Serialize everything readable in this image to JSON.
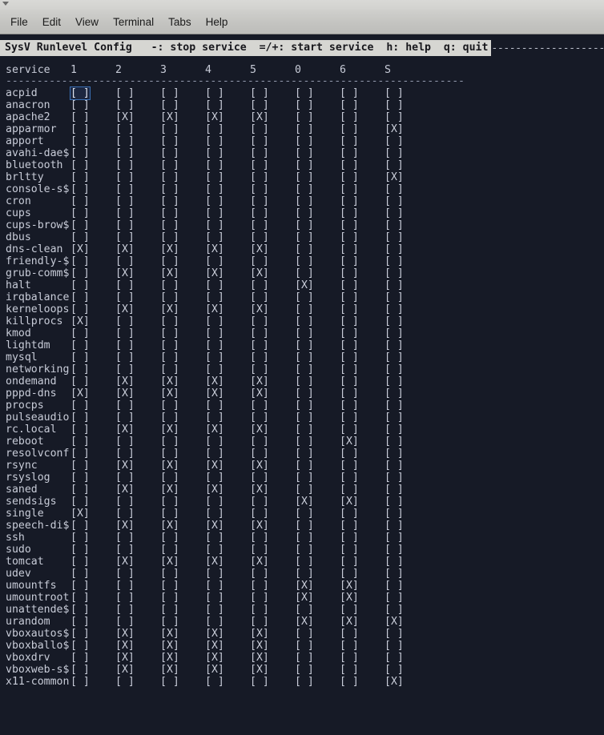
{
  "window": {
    "menu_marker_icon": "window-menu-triangle-icon",
    "menus": [
      "File",
      "Edit",
      "View",
      "Terminal",
      "Tabs",
      "Help"
    ]
  },
  "terminal": {
    "background_color": "#161a26",
    "foreground_color": "#c8ccd8",
    "status_bar_bg": "#d6d6d2",
    "status_bar_fg": "#17171c",
    "cursor_color": "#3a6fb5"
  },
  "app": {
    "title": "SysV Runlevel Config",
    "status_line": "SysV Runlevel Config   -: stop service  =/+: start service  h: help  q: quit",
    "keys": [
      {
        "key": "-",
        "action": "stop service"
      },
      {
        "key": "=/+",
        "action": "start service"
      },
      {
        "key": "h",
        "action": "help"
      },
      {
        "key": "q",
        "action": "quit"
      }
    ],
    "rule_char": "-"
  },
  "table": {
    "columns": [
      "service",
      "1",
      "2",
      "3",
      "4",
      "5",
      "0",
      "6",
      "S"
    ],
    "runlevels": [
      "1",
      "2",
      "3",
      "4",
      "5",
      "0",
      "6",
      "S"
    ],
    "divider": "--------------------------------------------------------------------------",
    "checked_glyph": "[X]",
    "unchecked_glyph": "[ ]",
    "cursor": {
      "row": 0,
      "col": 0
    },
    "rows": [
      {
        "service": "acpid",
        "states": [
          0,
          0,
          0,
          0,
          0,
          0,
          0,
          0
        ]
      },
      {
        "service": "anacron",
        "states": [
          0,
          0,
          0,
          0,
          0,
          0,
          0,
          0
        ]
      },
      {
        "service": "apache2",
        "states": [
          0,
          1,
          1,
          1,
          1,
          0,
          0,
          0
        ]
      },
      {
        "service": "apparmor",
        "states": [
          0,
          0,
          0,
          0,
          0,
          0,
          0,
          1
        ]
      },
      {
        "service": "apport",
        "states": [
          0,
          0,
          0,
          0,
          0,
          0,
          0,
          0
        ]
      },
      {
        "service": "avahi-dae$",
        "states": [
          0,
          0,
          0,
          0,
          0,
          0,
          0,
          0
        ]
      },
      {
        "service": "bluetooth",
        "states": [
          0,
          0,
          0,
          0,
          0,
          0,
          0,
          0
        ]
      },
      {
        "service": "brltty",
        "states": [
          0,
          0,
          0,
          0,
          0,
          0,
          0,
          1
        ]
      },
      {
        "service": "console-s$",
        "states": [
          0,
          0,
          0,
          0,
          0,
          0,
          0,
          0
        ]
      },
      {
        "service": "cron",
        "states": [
          0,
          0,
          0,
          0,
          0,
          0,
          0,
          0
        ]
      },
      {
        "service": "cups",
        "states": [
          0,
          0,
          0,
          0,
          0,
          0,
          0,
          0
        ]
      },
      {
        "service": "cups-brow$",
        "states": [
          0,
          0,
          0,
          0,
          0,
          0,
          0,
          0
        ]
      },
      {
        "service": "dbus",
        "states": [
          0,
          0,
          0,
          0,
          0,
          0,
          0,
          0
        ]
      },
      {
        "service": "dns-clean",
        "states": [
          1,
          1,
          1,
          1,
          1,
          0,
          0,
          0
        ]
      },
      {
        "service": "friendly-$",
        "states": [
          0,
          0,
          0,
          0,
          0,
          0,
          0,
          0
        ]
      },
      {
        "service": "grub-comm$",
        "states": [
          0,
          1,
          1,
          1,
          1,
          0,
          0,
          0
        ]
      },
      {
        "service": "halt",
        "states": [
          0,
          0,
          0,
          0,
          0,
          1,
          0,
          0
        ]
      },
      {
        "service": "irqbalance",
        "states": [
          0,
          0,
          0,
          0,
          0,
          0,
          0,
          0
        ]
      },
      {
        "service": "kerneloops",
        "states": [
          0,
          1,
          1,
          1,
          1,
          0,
          0,
          0
        ]
      },
      {
        "service": "killprocs",
        "states": [
          1,
          0,
          0,
          0,
          0,
          0,
          0,
          0
        ]
      },
      {
        "service": "kmod",
        "states": [
          0,
          0,
          0,
          0,
          0,
          0,
          0,
          0
        ]
      },
      {
        "service": "lightdm",
        "states": [
          0,
          0,
          0,
          0,
          0,
          0,
          0,
          0
        ]
      },
      {
        "service": "mysql",
        "states": [
          0,
          0,
          0,
          0,
          0,
          0,
          0,
          0
        ]
      },
      {
        "service": "networking",
        "states": [
          0,
          0,
          0,
          0,
          0,
          0,
          0,
          0
        ]
      },
      {
        "service": "ondemand",
        "states": [
          0,
          1,
          1,
          1,
          1,
          0,
          0,
          0
        ]
      },
      {
        "service": "pppd-dns",
        "states": [
          1,
          1,
          1,
          1,
          1,
          0,
          0,
          0
        ]
      },
      {
        "service": "procps",
        "states": [
          0,
          0,
          0,
          0,
          0,
          0,
          0,
          0
        ]
      },
      {
        "service": "pulseaudio",
        "states": [
          0,
          0,
          0,
          0,
          0,
          0,
          0,
          0
        ]
      },
      {
        "service": "rc.local",
        "states": [
          0,
          1,
          1,
          1,
          1,
          0,
          0,
          0
        ]
      },
      {
        "service": "reboot",
        "states": [
          0,
          0,
          0,
          0,
          0,
          0,
          1,
          0
        ]
      },
      {
        "service": "resolvconf",
        "states": [
          0,
          0,
          0,
          0,
          0,
          0,
          0,
          0
        ]
      },
      {
        "service": "rsync",
        "states": [
          0,
          1,
          1,
          1,
          1,
          0,
          0,
          0
        ]
      },
      {
        "service": "rsyslog",
        "states": [
          0,
          0,
          0,
          0,
          0,
          0,
          0,
          0
        ]
      },
      {
        "service": "saned",
        "states": [
          0,
          1,
          1,
          1,
          1,
          0,
          0,
          0
        ]
      },
      {
        "service": "sendsigs",
        "states": [
          0,
          0,
          0,
          0,
          0,
          1,
          1,
          0
        ]
      },
      {
        "service": "single",
        "states": [
          1,
          0,
          0,
          0,
          0,
          0,
          0,
          0
        ]
      },
      {
        "service": "speech-di$",
        "states": [
          0,
          1,
          1,
          1,
          1,
          0,
          0,
          0
        ]
      },
      {
        "service": "ssh",
        "states": [
          0,
          0,
          0,
          0,
          0,
          0,
          0,
          0
        ]
      },
      {
        "service": "sudo",
        "states": [
          0,
          0,
          0,
          0,
          0,
          0,
          0,
          0
        ]
      },
      {
        "service": "tomcat",
        "states": [
          0,
          1,
          1,
          1,
          1,
          0,
          0,
          0
        ]
      },
      {
        "service": "udev",
        "states": [
          0,
          0,
          0,
          0,
          0,
          0,
          0,
          0
        ]
      },
      {
        "service": "umountfs",
        "states": [
          0,
          0,
          0,
          0,
          0,
          1,
          1,
          0
        ]
      },
      {
        "service": "umountroot",
        "states": [
          0,
          0,
          0,
          0,
          0,
          1,
          1,
          0
        ]
      },
      {
        "service": "unattende$",
        "states": [
          0,
          0,
          0,
          0,
          0,
          0,
          0,
          0
        ]
      },
      {
        "service": "urandom",
        "states": [
          0,
          0,
          0,
          0,
          0,
          1,
          1,
          1
        ]
      },
      {
        "service": "vboxautos$",
        "states": [
          0,
          1,
          1,
          1,
          1,
          0,
          0,
          0
        ]
      },
      {
        "service": "vboxballo$",
        "states": [
          0,
          1,
          1,
          1,
          1,
          0,
          0,
          0
        ]
      },
      {
        "service": "vboxdrv",
        "states": [
          0,
          1,
          1,
          1,
          1,
          0,
          0,
          0
        ]
      },
      {
        "service": "vboxweb-s$",
        "states": [
          0,
          1,
          1,
          1,
          1,
          0,
          0,
          0
        ]
      },
      {
        "service": "x11-common",
        "states": [
          0,
          0,
          0,
          0,
          0,
          0,
          0,
          1
        ]
      }
    ]
  }
}
